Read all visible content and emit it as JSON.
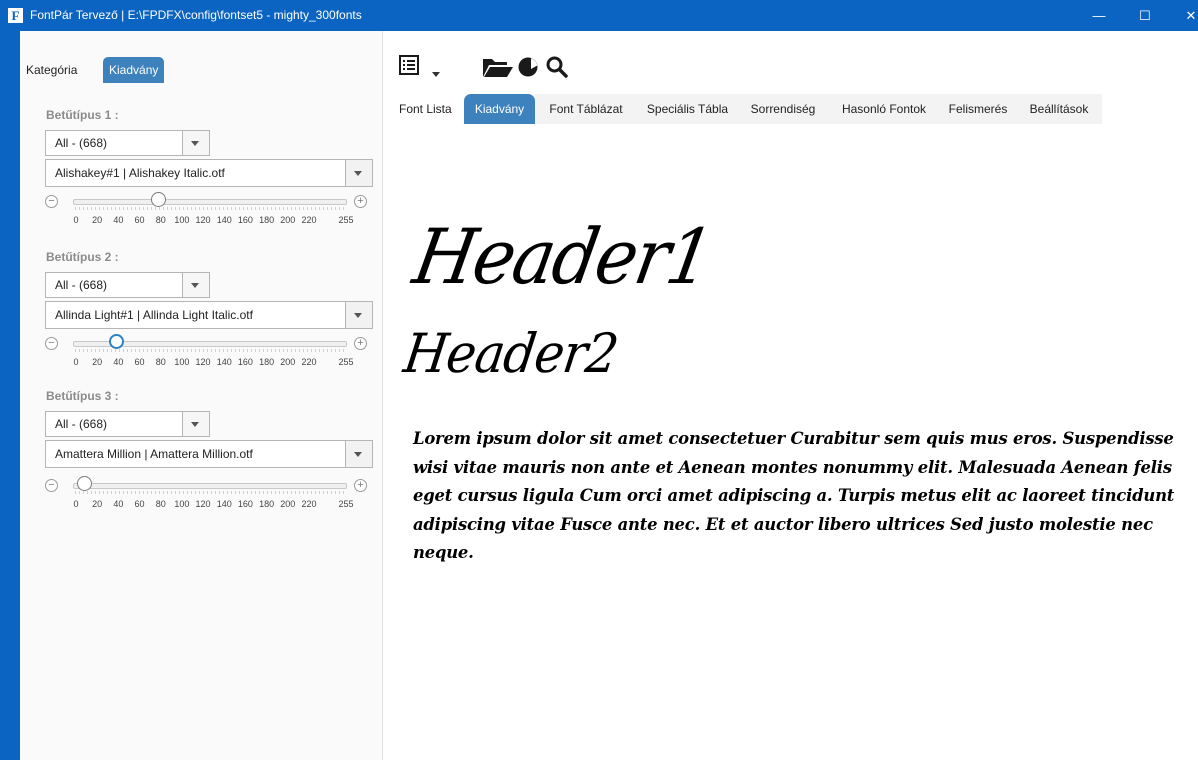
{
  "window": {
    "title": "FontPár Tervező | E:\\FPDFX\\config\\fontset5 - mighty_300fonts",
    "app_icon": "F",
    "minimize_glyph": "—",
    "maximize_glyph": "☐",
    "close_glyph": "✕"
  },
  "sidebar": {
    "tabs": [
      {
        "label": "Kategória",
        "active": false
      },
      {
        "label": "Kiadvány",
        "active": true
      }
    ],
    "fonts": [
      {
        "label": "Betűtípus 1 :",
        "category": "All - (668)",
        "font": "Alishakey#1 | Alishakey Italic.otf",
        "size": 80
      },
      {
        "label": "Betűtípus 2 :",
        "category": "All - (668)",
        "font": "Allinda Light#1 | Allinda Light Italic.otf",
        "size": 40
      },
      {
        "label": "Betűtípus 3 :",
        "category": "All - (668)",
        "font": "Amattera Million | Amattera Million.otf",
        "size": 10
      }
    ],
    "slider": {
      "min": 0,
      "max": 255,
      "ticks": [
        "0",
        "20",
        "40",
        "60",
        "80",
        "100",
        "120",
        "140",
        "160",
        "180",
        "200",
        "220",
        "255"
      ],
      "minus_glyph": "−",
      "plus_glyph": "+"
    }
  },
  "toolbar": {
    "icons": [
      "list-icon",
      "dropdown-arrow-icon",
      "folder-open-icon",
      "contrast-icon",
      "search-icon"
    ]
  },
  "main_tabs": [
    {
      "label": "Font Lista",
      "active": false
    },
    {
      "label": "Kiadvány",
      "active": true
    },
    {
      "label": "Font Táblázat",
      "active": false
    },
    {
      "label": "Speciális Tábla",
      "active": false
    },
    {
      "label": "Sorrendiség",
      "active": false
    },
    {
      "label": "Hasonló Fontok",
      "active": false
    },
    {
      "label": "Felismerés",
      "active": false
    },
    {
      "label": "Beállítások",
      "active": false
    }
  ],
  "preview": {
    "header1": "Header1",
    "header2": "Header2",
    "body": "Lorem ipsum dolor sit amet consectetuer Curabitur sem quis mus eros. Suspendisse wisi vitae mauris non ante et Aenean montes nonummy elit. Malesuada Aenean felis eget cursus ligula Cum orci amet adipiscing a. Turpis metus elit ac laoreet tincidunt adipiscing vitae Fusce ante nec. Et et auctor libero ultrices Sed justo molestie nec neque."
  },
  "colors": {
    "titlebar": "#0b63c2",
    "accent": "#3d82bd",
    "slider_focus": "#2b82c6"
  }
}
